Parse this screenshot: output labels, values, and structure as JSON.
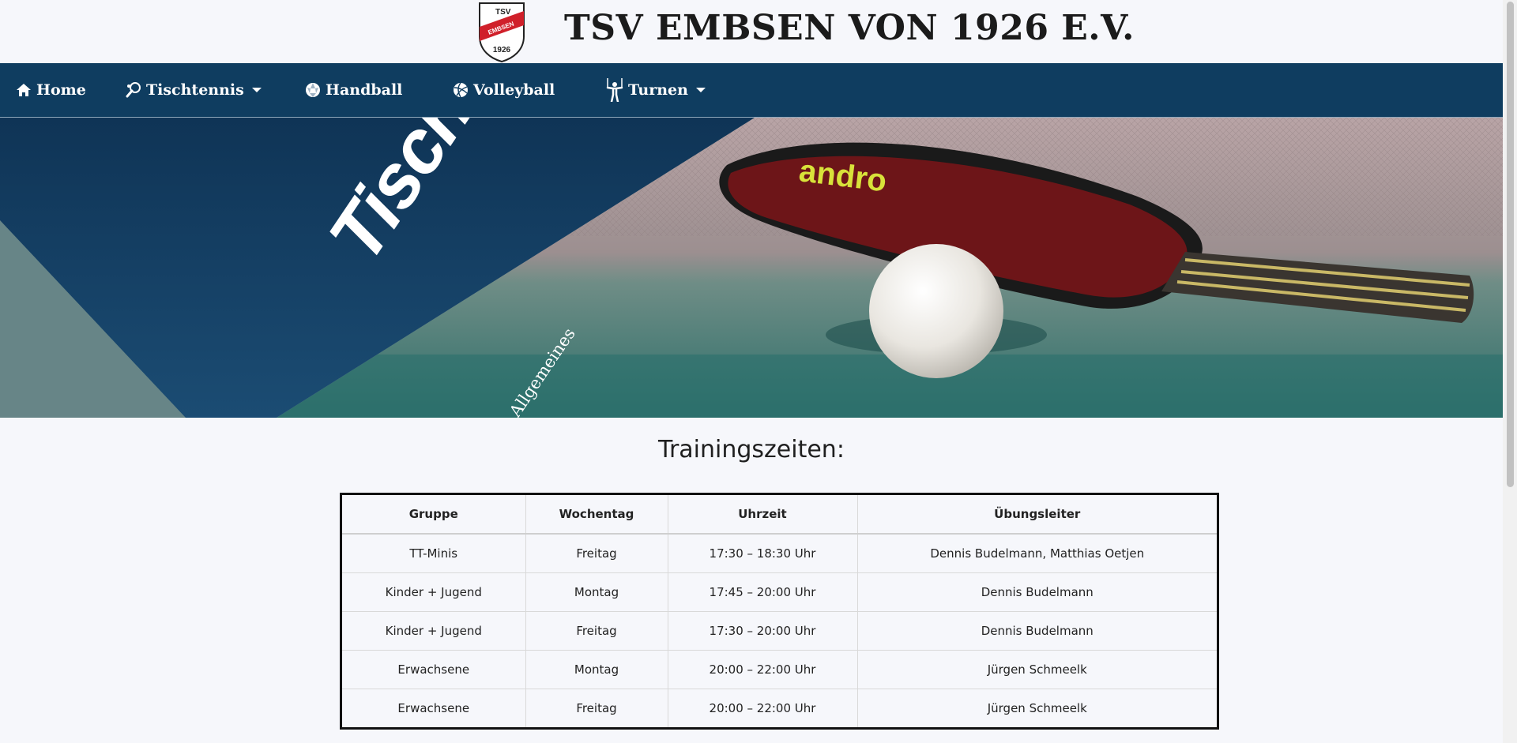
{
  "header": {
    "title": "TSV EMBSEN VON 1926 E.V.",
    "logo": {
      "text_top": "TSV",
      "text_band": "EMBSEN",
      "text_bottom": "1926"
    }
  },
  "nav": {
    "items": [
      {
        "label": "Home",
        "icon": "home-icon",
        "dropdown": false
      },
      {
        "label": "Tischtennis",
        "icon": "table-tennis-paddle-icon",
        "dropdown": true
      },
      {
        "label": "Handball",
        "icon": "handball-icon",
        "dropdown": false
      },
      {
        "label": "Volleyball",
        "icon": "volleyball-icon",
        "dropdown": false
      },
      {
        "label": "Turnen",
        "icon": "gymnast-icon",
        "dropdown": true
      }
    ]
  },
  "banner": {
    "title": "Tischtennis",
    "subtitle": "Allgemeines",
    "paddle_brand": "andro"
  },
  "section": {
    "title": "Trainingszeiten:"
  },
  "table": {
    "headers": [
      "Gruppe",
      "Wochentag",
      "Uhrzeit",
      "Übungsleiter"
    ],
    "rows": [
      [
        "TT-Minis",
        "Freitag",
        "17:30 – 18:30 Uhr",
        "Dennis Budelmann, Matthias Oetjen"
      ],
      [
        "Kinder + Jugend",
        "Montag",
        "17:45 – 20:00 Uhr",
        "Dennis Budelmann"
      ],
      [
        "Kinder + Jugend",
        "Freitag",
        "17:30 – 20:00 Uhr",
        "Dennis Budelmann"
      ],
      [
        "Erwachsene",
        "Montag",
        "20:00 – 22:00 Uhr",
        "Jürgen Schmeelk"
      ],
      [
        "Erwachsene",
        "Freitag",
        "20:00 – 22:00 Uhr",
        "Jürgen Schmeelk"
      ]
    ]
  },
  "colors": {
    "nav_bg": "#0f3d60",
    "banner_panel": "#113a5c",
    "logo_red": "#d0202a"
  }
}
